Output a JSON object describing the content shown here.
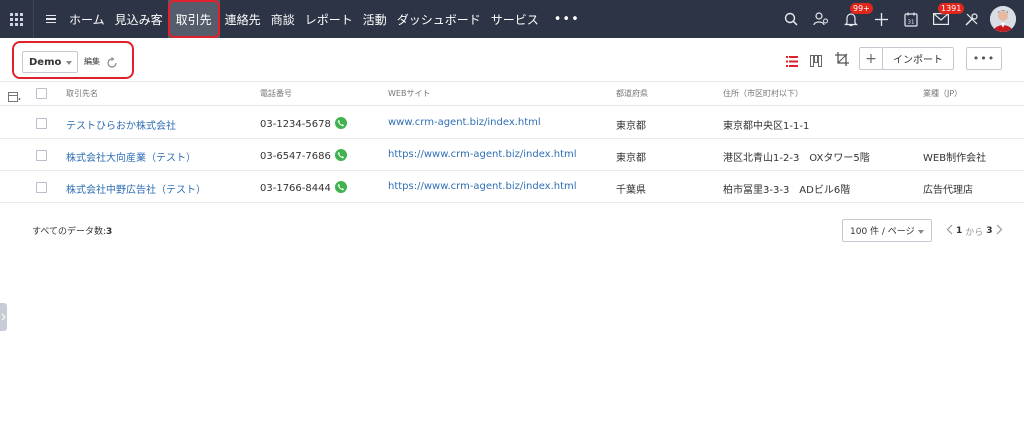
{
  "nav": {
    "items": [
      {
        "label": "ホーム",
        "active": false
      },
      {
        "label": "見込み客",
        "active": false
      },
      {
        "label": "取引先",
        "active": true
      },
      {
        "label": "連絡先",
        "active": false
      },
      {
        "label": "商談",
        "active": false
      },
      {
        "label": "レポート",
        "active": false
      },
      {
        "label": "活動",
        "active": false
      },
      {
        "label": "ダッシュボード",
        "active": false
      },
      {
        "label": "サービス",
        "active": false
      }
    ],
    "more": "•••",
    "notifications_badge": "99+",
    "mail_badge": "1391",
    "calendar_day": "31"
  },
  "toolbar": {
    "view_name": "Demo",
    "edit_label": "編集",
    "add_label": "+",
    "import_label": "インポート",
    "more_label": "•••"
  },
  "table": {
    "columns": [
      "取引先名",
      "電話番号",
      "WEBサイト",
      "都道府県",
      "住所（市区町村以下）",
      "業種（JP）"
    ],
    "rows": [
      {
        "name": "テストひらおか株式会社",
        "phone": "03-1234-5678",
        "website": "www.crm-agent.biz/index.html",
        "prefecture": "東京都",
        "address": "東京都中央区1-1-1",
        "industry": ""
      },
      {
        "name": "株式会社大向産業（テスト）",
        "phone": "03-6547-7686",
        "website": "https://www.crm-agent.biz/index.html",
        "prefecture": "東京都",
        "address": "港区北青山1-2-3　OXタワー5階",
        "industry": "WEB制作会社"
      },
      {
        "name": "株式会社中野広告社（テスト）",
        "phone": "03-1766-8444",
        "website": "https://www.crm-agent.biz/index.html",
        "prefecture": "千葉県",
        "address": "柏市冨里3-3-3　ADビル6階",
        "industry": "広告代理店"
      }
    ]
  },
  "footer": {
    "total_label": "すべてのデータ数:",
    "total_count": "3",
    "per_page": "100 件 / ページ",
    "pager_start": "1",
    "pager_from": "から",
    "pager_end": "3"
  },
  "colors": {
    "topbar": "#2d3445",
    "highlight": "#e0212b",
    "link": "#2f6fb5",
    "phone_icon": "#3fb34f"
  }
}
